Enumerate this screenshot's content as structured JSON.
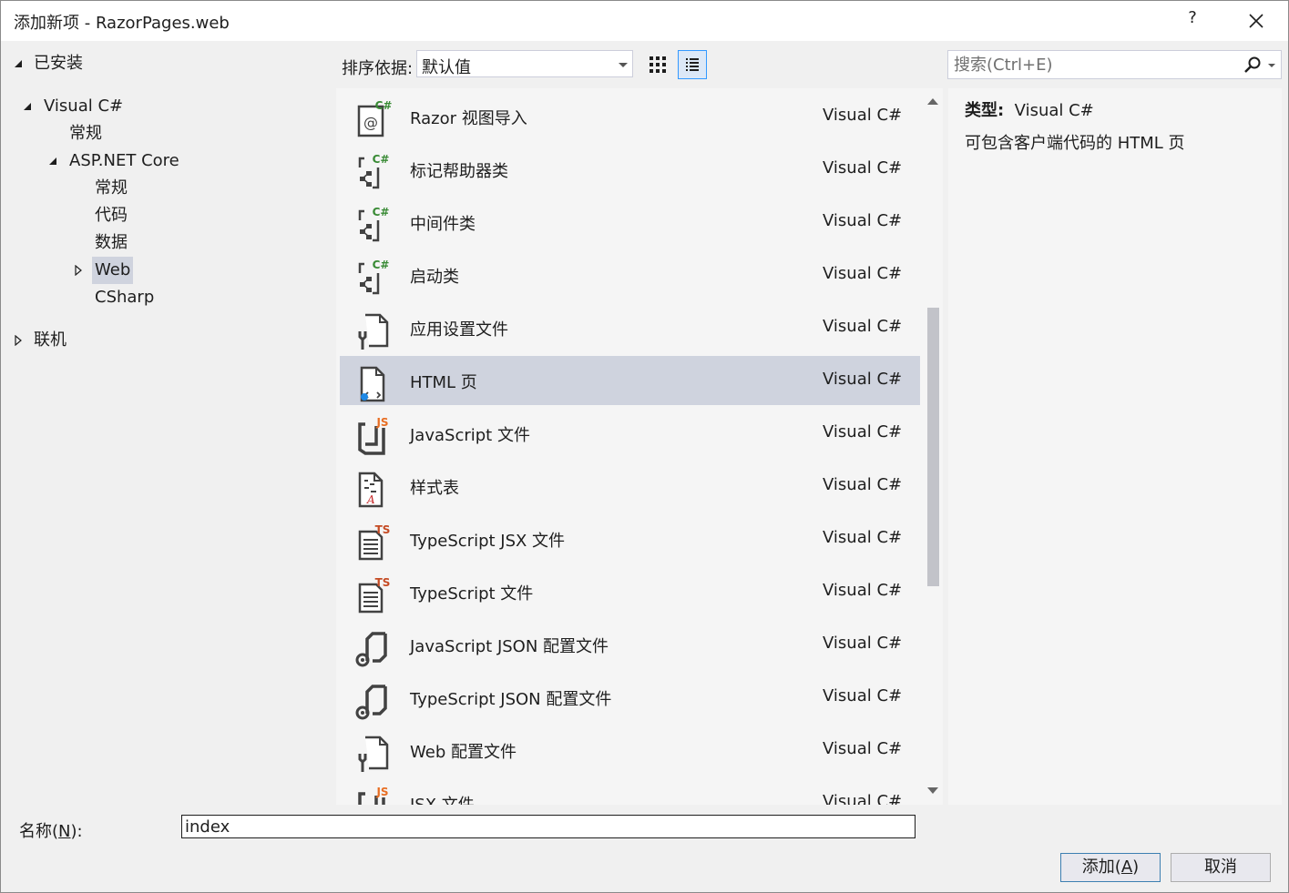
{
  "dialog": {
    "title": "添加新项 - RazorPages.web",
    "help_label": "?"
  },
  "tree": {
    "installed": "已安装",
    "visual_csharp": "Visual C#",
    "general": "常规",
    "aspnet_core": "ASP.NET Core",
    "aspnet_children": [
      "常规",
      "代码",
      "数据",
      "Web",
      "CSharp"
    ],
    "online": "联机",
    "selected": "Web"
  },
  "toolbar": {
    "sort_label": "排序依据:",
    "sort_value": "默认值",
    "search_placeholder": "搜索(Ctrl+E)"
  },
  "items": [
    {
      "name": "Razor 视图导入",
      "type": "Visual C#",
      "icon": "razor-view-import-icon"
    },
    {
      "name": "标记帮助器类",
      "type": "Visual C#",
      "icon": "csharp-class-icon"
    },
    {
      "name": "中间件类",
      "type": "Visual C#",
      "icon": "csharp-class-icon"
    },
    {
      "name": "启动类",
      "type": "Visual C#",
      "icon": "csharp-class-icon"
    },
    {
      "name": "应用设置文件",
      "type": "Visual C#",
      "icon": "config-file-icon"
    },
    {
      "name": "HTML 页",
      "type": "Visual C#",
      "icon": "html-page-icon",
      "selected": true
    },
    {
      "name": "JavaScript 文件",
      "type": "Visual C#",
      "icon": "javascript-file-icon"
    },
    {
      "name": "样式表",
      "type": "Visual C#",
      "icon": "stylesheet-icon"
    },
    {
      "name": "TypeScript JSX 文件",
      "type": "Visual C#",
      "icon": "typescript-file-icon"
    },
    {
      "name": "TypeScript 文件",
      "type": "Visual C#",
      "icon": "typescript-file-icon"
    },
    {
      "name": "JavaScript JSON 配置文件",
      "type": "Visual C#",
      "icon": "json-config-icon"
    },
    {
      "name": "TypeScript JSON 配置文件",
      "type": "Visual C#",
      "icon": "json-config-icon"
    },
    {
      "name": "Web 配置文件",
      "type": "Visual C#",
      "icon": "config-file-icon"
    },
    {
      "name": "JSX 文件",
      "type": "Visual C#",
      "icon": "jsx-file-icon"
    }
  ],
  "details": {
    "type_label": "类型:",
    "type_value": "Visual C#",
    "description": "可包含客户端代码的 HTML 页"
  },
  "bottom": {
    "name_label_prefix": "名称(",
    "name_label_key": "N",
    "name_label_suffix": "):",
    "name_value": "index",
    "add_prefix": "添加(",
    "add_key": "A",
    "add_suffix": ")",
    "cancel_label": "取消"
  },
  "colors": {
    "selection": "#cfd3de",
    "accent": "#3399ff",
    "csharp_badge": "#388a34",
    "js_badge": "#e86e23",
    "ts_badge": "#c54b24"
  }
}
